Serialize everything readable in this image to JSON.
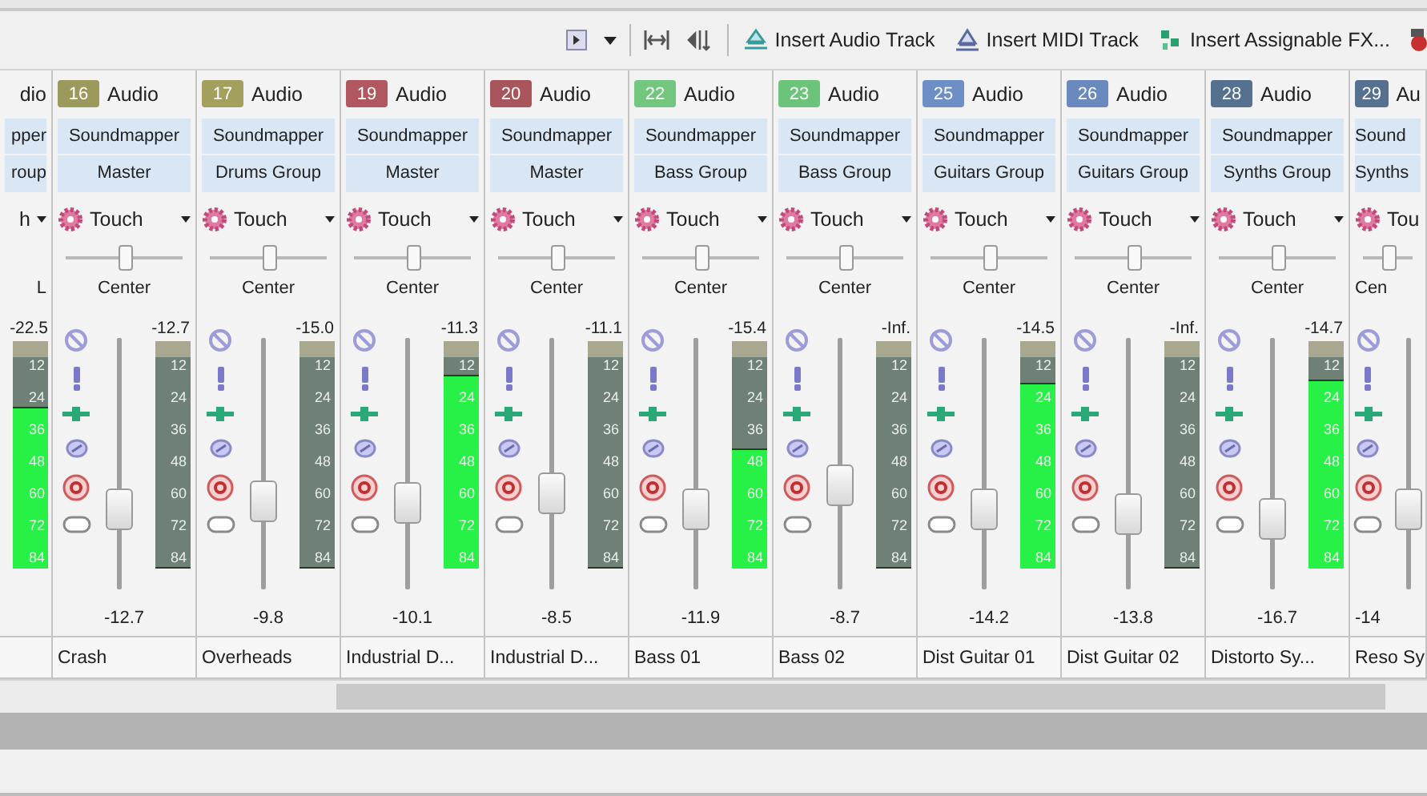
{
  "toolbar": {
    "actions": [
      {
        "label": "Insert Audio Track",
        "kind": "audio"
      },
      {
        "label": "Insert MIDI Track",
        "kind": "midi"
      },
      {
        "label": "Insert Assignable FX...",
        "kind": "fx"
      }
    ]
  },
  "strips": [
    {
      "kind": "cut_left",
      "label": "dio",
      "output": "pper",
      "group": "roup",
      "automation": "h",
      "pan": {
        "label": "L"
      },
      "meter": {
        "peak": "-22.5",
        "level": 0.7,
        "scale": [
          "12",
          "24",
          "36",
          "48",
          "60",
          "72",
          "84"
        ]
      }
    },
    {
      "kind": "full",
      "number": "16",
      "color": "#9b9a5c",
      "label": "Audio",
      "output": "Soundmapper",
      "group": "Master",
      "automation": "Touch",
      "pan": {
        "level": 0.5,
        "label": "Center"
      },
      "meter": {
        "peak": "-12.7",
        "level": 0,
        "scale": [
          "12",
          "24",
          "36",
          "48",
          "60",
          "72",
          "84"
        ]
      },
      "fader": {
        "level": 0.32,
        "value": "-12.7"
      },
      "name": "Crash"
    },
    {
      "kind": "full",
      "number": "17",
      "color": "#a3a05e",
      "label": "Audio",
      "output": "Soundmapper",
      "group": "Drums Group",
      "automation": "Touch",
      "pan": {
        "level": 0.5,
        "label": "Center"
      },
      "meter": {
        "peak": "-15.0",
        "level": 0,
        "scale": [
          "12",
          "24",
          "36",
          "48",
          "60",
          "72",
          "84"
        ]
      },
      "fader": {
        "level": 0.35,
        "value": "-9.8"
      },
      "name": "Overheads"
    },
    {
      "kind": "full",
      "number": "19",
      "color": "#b0575f",
      "label": "Audio",
      "output": "Soundmapper",
      "group": "Master",
      "automation": "Touch",
      "pan": {
        "level": 0.5,
        "label": "Center"
      },
      "meter": {
        "peak": "-11.3",
        "level": 0.84,
        "scale": [
          "12",
          "24",
          "36",
          "48",
          "60",
          "72",
          "84"
        ]
      },
      "fader": {
        "level": 0.34,
        "value": "-10.1"
      },
      "name": "Industrial D..."
    },
    {
      "kind": "full",
      "number": "20",
      "color": "#a8555c",
      "label": "Audio",
      "output": "Soundmapper",
      "group": "Master",
      "automation": "Touch",
      "pan": {
        "level": 0.5,
        "label": "Center"
      },
      "meter": {
        "peak": "-11.1",
        "level": 0,
        "scale": [
          "12",
          "24",
          "36",
          "48",
          "60",
          "72",
          "84"
        ]
      },
      "fader": {
        "level": 0.38,
        "value": "-8.5"
      },
      "name": "Industrial D..."
    },
    {
      "kind": "full",
      "number": "22",
      "color": "#72c67e",
      "label": "Audio",
      "output": "Soundmapper",
      "group": "Bass Group",
      "automation": "Touch",
      "pan": {
        "level": 0.5,
        "label": "Center"
      },
      "meter": {
        "peak": "-15.4",
        "level": 0.52,
        "scale": [
          "12",
          "24",
          "36",
          "48",
          "60",
          "72",
          "84"
        ]
      },
      "fader": {
        "level": 0.32,
        "value": "-11.9"
      },
      "name": "Bass 01"
    },
    {
      "kind": "full",
      "number": "23",
      "color": "#6cc47a",
      "label": "Audio",
      "output": "Soundmapper",
      "group": "Bass Group",
      "automation": "Touch",
      "pan": {
        "level": 0.5,
        "label": "Center"
      },
      "meter": {
        "peak": "-Inf.",
        "level": 0,
        "scale": [
          "12",
          "24",
          "36",
          "48",
          "60",
          "72",
          "84"
        ]
      },
      "fader": {
        "level": 0.41,
        "value": "-8.7"
      },
      "name": "Bass 02"
    },
    {
      "kind": "full",
      "number": "25",
      "color": "#6d8fc6",
      "label": "Audio",
      "output": "Soundmapper",
      "group": "Guitars Group",
      "automation": "Touch",
      "pan": {
        "level": 0.5,
        "label": "Center"
      },
      "meter": {
        "peak": "-14.5",
        "level": 0.81,
        "scale": [
          "12",
          "24",
          "36",
          "48",
          "60",
          "72",
          "84"
        ]
      },
      "fader": {
        "level": 0.32,
        "value": "-14.2"
      },
      "name": "Dist Guitar 01"
    },
    {
      "kind": "full",
      "number": "26",
      "color": "#6a89bf",
      "label": "Audio",
      "output": "Soundmapper",
      "group": "Guitars Group",
      "automation": "Touch",
      "pan": {
        "level": 0.5,
        "label": "Center"
      },
      "meter": {
        "peak": "-Inf.",
        "level": 0,
        "scale": [
          "12",
          "24",
          "36",
          "48",
          "60",
          "72",
          "84"
        ]
      },
      "fader": {
        "level": 0.3,
        "value": "-13.8"
      },
      "name": "Dist Guitar 02"
    },
    {
      "kind": "full",
      "number": "28",
      "color": "#56708f",
      "label": "Audio",
      "output": "Soundmapper",
      "group": "Synths Group",
      "automation": "Touch",
      "pan": {
        "level": 0.5,
        "label": "Center"
      },
      "meter": {
        "peak": "-14.7",
        "level": 0.82,
        "scale": [
          "12",
          "24",
          "36",
          "48",
          "60",
          "72",
          "84"
        ]
      },
      "fader": {
        "level": 0.28,
        "value": "-16.7"
      },
      "name": "Distorto Sy..."
    },
    {
      "kind": "cut_right",
      "number": "29",
      "color": "#56708f",
      "label": "Au",
      "output": "Sound",
      "group": "Synths",
      "automation": "Tou",
      "pan": {
        "level": 0.5,
        "label": "Cen"
      },
      "fader": {
        "level": 0.32,
        "value": "-14"
      },
      "name": "Reso Sy"
    }
  ]
}
